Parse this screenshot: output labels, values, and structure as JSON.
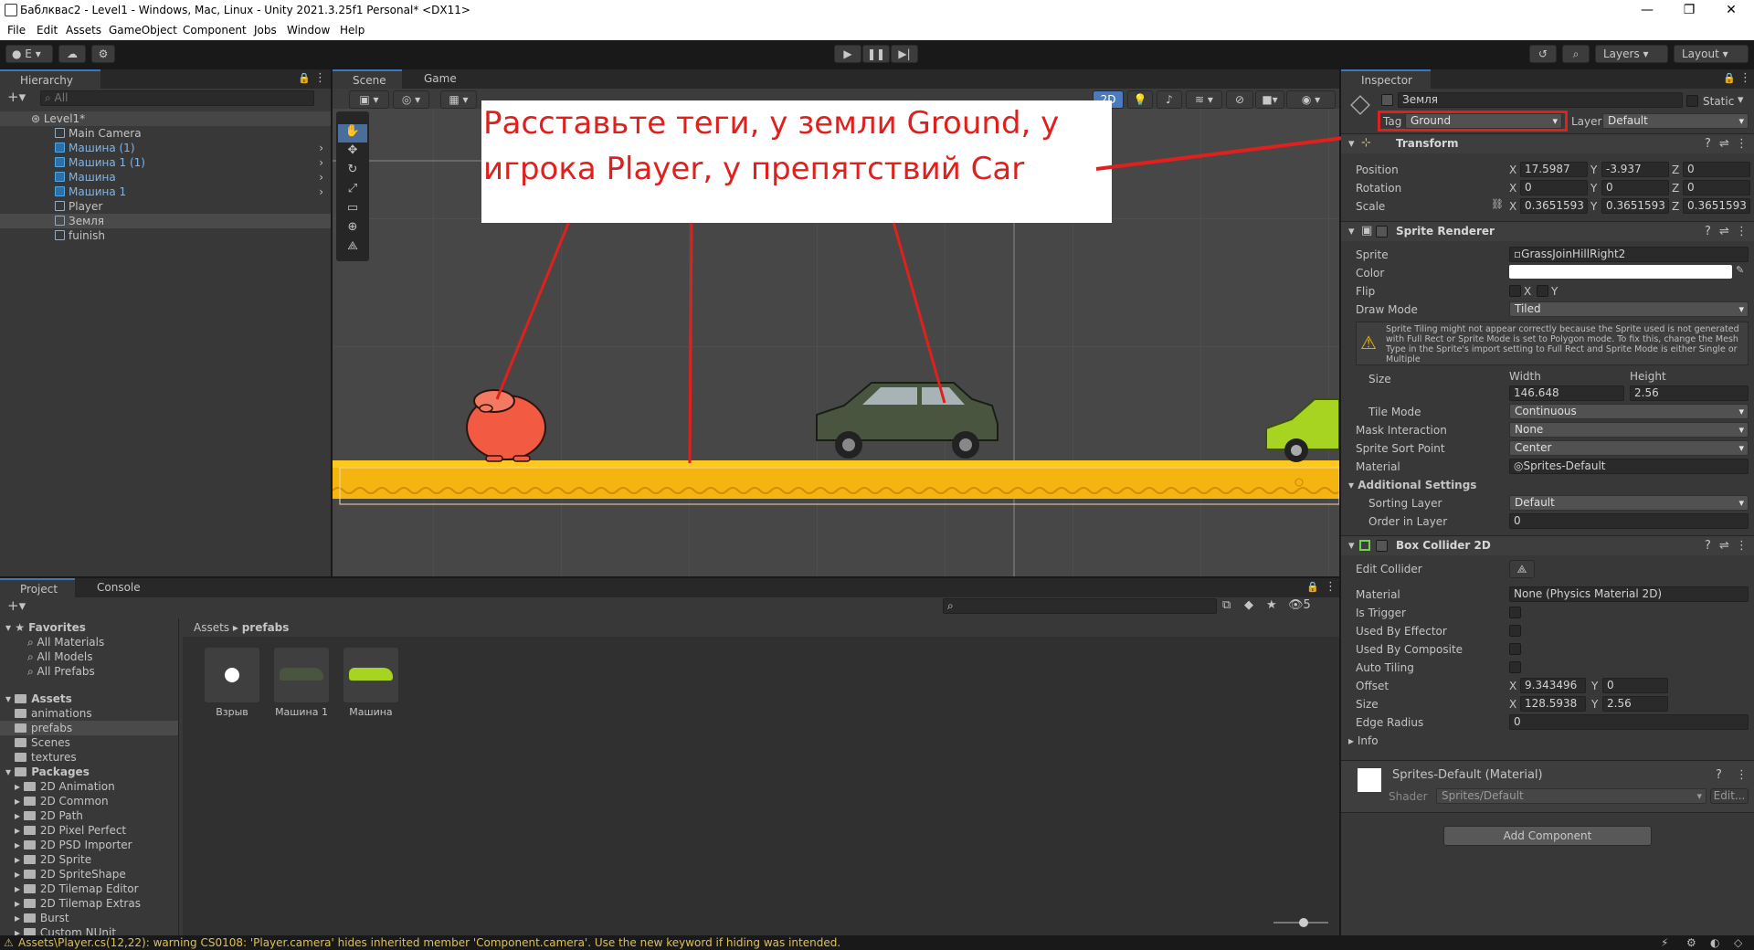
{
  "window": {
    "title": "Баблквас2 - Level1 - Windows, Mac, Linux - Unity 2021.3.25f1 Personal* <DX11>"
  },
  "menu": [
    "File",
    "Edit",
    "Assets",
    "GameObject",
    "Component",
    "Jobs",
    "Window",
    "Help"
  ],
  "toolbar": {
    "account": "E",
    "layers": "Layers",
    "layout": "Layout"
  },
  "hierarchy": {
    "tab": "Hierarchy",
    "search_placeholder": "All",
    "scene": "Level1*",
    "items": [
      {
        "label": "Main Camera",
        "prefab": false
      },
      {
        "label": "Машина (1)",
        "prefab": true
      },
      {
        "label": "Машина 1 (1)",
        "prefab": true
      },
      {
        "label": "Машина",
        "prefab": true
      },
      {
        "label": "Машина 1",
        "prefab": true
      },
      {
        "label": "Player",
        "prefab": false
      },
      {
        "label": "Земля",
        "prefab": false
      },
      {
        "label": "fuinish",
        "prefab": false
      }
    ]
  },
  "scene_tabs": {
    "scene": "Scene",
    "game": "Game",
    "mode_2d": "2D"
  },
  "annotation": {
    "text": "Расставьте теги, у земли Ground, у игрока Player, у препятствий Car"
  },
  "project": {
    "tab_project": "Project",
    "tab_console": "Console",
    "hidden_count": "5",
    "breadcrumb": [
      "Assets",
      "prefabs"
    ],
    "favorites_label": "Favorites",
    "favorites": [
      "All Materials",
      "All Models",
      "All Prefabs"
    ],
    "assets_label": "Assets",
    "assets": [
      "animations",
      "prefabs",
      "Scenes",
      "textures"
    ],
    "packages_label": "Packages",
    "packages": [
      "2D Animation",
      "2D Common",
      "2D Path",
      "2D Pixel Perfect",
      "2D PSD Importer",
      "2D Sprite",
      "2D SpriteShape",
      "2D Tilemap Editor",
      "2D Tilemap Extras",
      "Burst",
      "Custom NUnit"
    ],
    "prefabs": [
      "Взрыв",
      "Машина 1",
      "Машина"
    ]
  },
  "status": {
    "message": "Assets\\Player.cs(12,22): warning CS0108: 'Player.camera' hides inherited member 'Component.camera'. Use the new keyword if hiding was intended."
  },
  "inspector": {
    "tab": "Inspector",
    "object_name": "Земля",
    "static_label": "Static",
    "tag_label": "Tag",
    "tag_value": "Ground",
    "layer_label": "Layer",
    "layer_value": "Default",
    "transform": {
      "title": "Transform",
      "position_label": "Position",
      "position": [
        "17.5987",
        "-3.937",
        "0"
      ],
      "rotation_label": "Rotation",
      "rotation": [
        "0",
        "0",
        "0"
      ],
      "scale_label": "Scale",
      "scale": [
        "0.3651593",
        "0.3651593",
        "0.3651593"
      ]
    },
    "sprite_renderer": {
      "title": "Sprite Renderer",
      "sprite_label": "Sprite",
      "sprite_value": "GrassJoinHillRight2",
      "color_label": "Color",
      "flip_label": "Flip",
      "flip_x": "X",
      "flip_y": "Y",
      "draw_mode_label": "Draw Mode",
      "draw_mode_value": "Tiled",
      "warning": "Sprite Tiling might not appear correctly because the Sprite used is not generated with Full Rect or Sprite Mode is set to Polygon mode. To fix this, change the Mesh Type in the Sprite's import setting to Full Rect and Sprite Mode is either Single or Multiple",
      "size_label": "Size",
      "width_label": "Width",
      "height_label": "Height",
      "width": "146.648",
      "height": "2.56",
      "tile_mode_label": "Tile Mode",
      "tile_mode": "Continuous",
      "mask_label": "Mask Interaction",
      "mask": "None",
      "sort_point_label": "Sprite Sort Point",
      "sort_point": "Center",
      "material_label": "Material",
      "material": "Sprites-Default",
      "additional": "Additional Settings",
      "sorting_layer_label": "Sorting Layer",
      "sorting_layer": "Default",
      "order_label": "Order in Layer",
      "order": "0"
    },
    "box_collider": {
      "title": "Box Collider 2D",
      "edit_label": "Edit Collider",
      "material_label": "Material",
      "material": "None (Physics Material 2D)",
      "trigger_label": "Is Trigger",
      "effector_label": "Used By Effector",
      "composite_label": "Used By Composite",
      "autotiling_label": "Auto Tiling",
      "offset_label": "Offset",
      "offset": [
        "9.343496",
        "0"
      ],
      "size_label": "Size",
      "size": [
        "128.5938",
        "2.56"
      ],
      "edge_label": "Edge Radius",
      "edge": "0",
      "info_label": "Info"
    },
    "material": {
      "name": "Sprites-Default (Material)",
      "shader_label": "Shader",
      "shader": "Sprites/Default",
      "edit": "Edit..."
    },
    "add_component": "Add Component"
  },
  "colors": {
    "accent": "#3a79bb",
    "ground": "#f5b510",
    "annotation": "#e0201d",
    "player": "#f25a42",
    "car_dark": "#4a5540",
    "car_light": "#a7d321"
  }
}
